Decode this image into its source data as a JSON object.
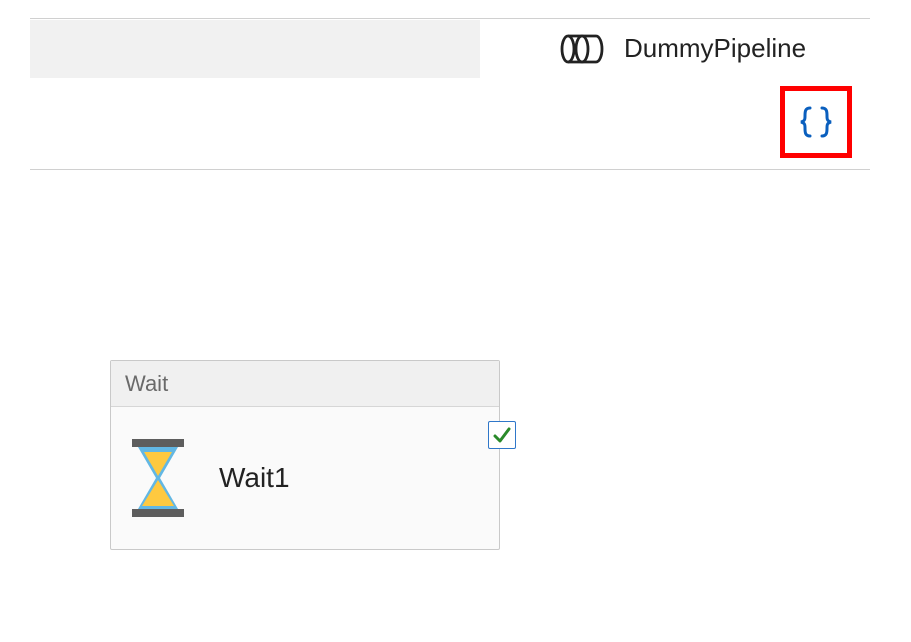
{
  "header": {
    "pipeline_title": "DummyPipeline"
  },
  "activity": {
    "type_label": "Wait",
    "instance_name": "Wait1"
  },
  "icons": {
    "pipeline": "pipeline-icon",
    "json_braces": "json-braces-icon",
    "hourglass": "hourglass-icon",
    "checkmark": "checkmark-icon"
  },
  "colors": {
    "highlight_red": "#ff0000",
    "accent_blue": "#0a5fbe",
    "hourglass_sand": "#fec940",
    "hourglass_glass": "#62b7e4",
    "hourglass_frame": "#5d5d5d",
    "success_green": "#2a8a2a"
  }
}
